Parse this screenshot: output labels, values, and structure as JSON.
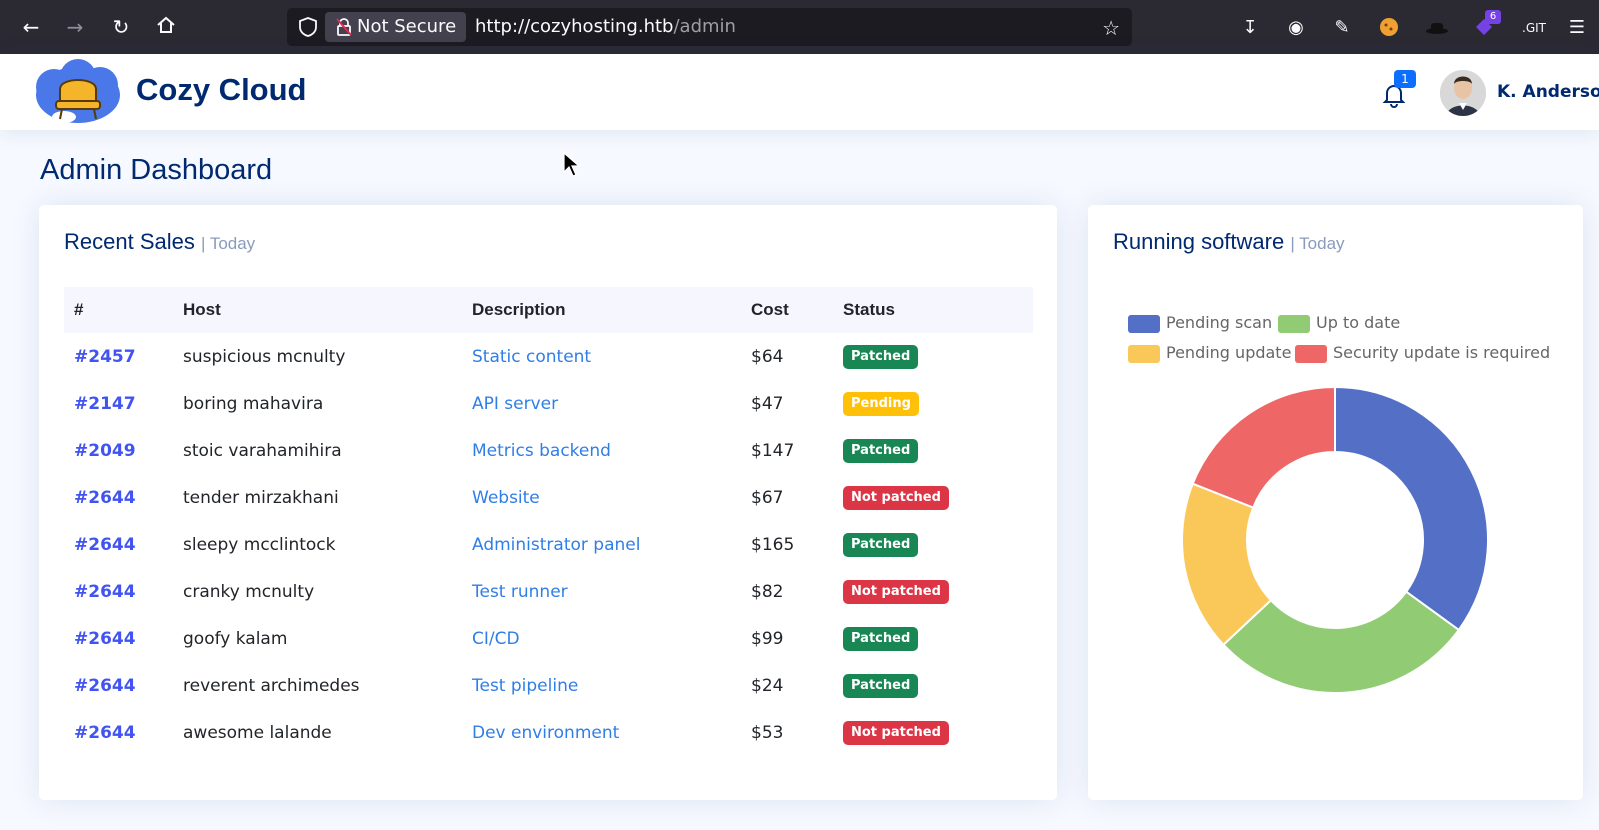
{
  "browser": {
    "security_label": "Not Secure",
    "url_host": "http://cozyhosting.htb",
    "url_path": "/admin",
    "extension_badge": "6"
  },
  "header": {
    "brand": "Cozy Cloud",
    "notification_count": "1",
    "user_name": "K. Anderson"
  },
  "page": {
    "title": "Admin Dashboard"
  },
  "sales": {
    "title": "Recent Sales",
    "subtitle": "| Today",
    "columns": [
      "#",
      "Host",
      "Description",
      "Cost",
      "Status"
    ],
    "rows": [
      {
        "id": "#2457",
        "host": "suspicious mcnulty",
        "description": "Static content",
        "cost": "$64",
        "status": "Patched",
        "status_color": "#198754"
      },
      {
        "id": "#2147",
        "host": "boring mahavira",
        "description": "API server",
        "cost": "$47",
        "status": "Pending",
        "status_color": "#ffc107"
      },
      {
        "id": "#2049",
        "host": "stoic varahamihira",
        "description": "Metrics backend",
        "cost": "$147",
        "status": "Patched",
        "status_color": "#198754"
      },
      {
        "id": "#2644",
        "host": "tender mirzakhani",
        "description": "Website",
        "cost": "$67",
        "status": "Not patched",
        "status_color": "#dc3545"
      },
      {
        "id": "#2644",
        "host": "sleepy mcclintock",
        "description": "Administrator panel",
        "cost": "$165",
        "status": "Patched",
        "status_color": "#198754"
      },
      {
        "id": "#2644",
        "host": "cranky mcnulty",
        "description": "Test runner",
        "cost": "$82",
        "status": "Not patched",
        "status_color": "#dc3545"
      },
      {
        "id": "#2644",
        "host": "goofy kalam",
        "description": "CI/CD",
        "cost": "$99",
        "status": "Patched",
        "status_color": "#198754"
      },
      {
        "id": "#2644",
        "host": "reverent archimedes",
        "description": "Test pipeline",
        "cost": "$24",
        "status": "Patched",
        "status_color": "#198754"
      },
      {
        "id": "#2644",
        "host": "awesome lalande",
        "description": "Dev environment",
        "cost": "$53",
        "status": "Not patched",
        "status_color": "#dc3545"
      }
    ]
  },
  "software": {
    "title": "Running software",
    "subtitle": "| Today"
  },
  "chart_data": {
    "type": "pie",
    "variant": "doughnut",
    "legend_position": "top",
    "series": [
      {
        "name": "Pending scan",
        "value": 35,
        "color": "#5470c6"
      },
      {
        "name": "Up to date",
        "value": 28,
        "color": "#91cc75"
      },
      {
        "name": "Pending update",
        "value": 18,
        "color": "#fac858"
      },
      {
        "name": "Security update is required",
        "value": 19,
        "color": "#ee6666"
      }
    ]
  },
  "colors": {
    "brand": "#012970",
    "link": "#2f7ee7",
    "id_link": "#4154f1"
  }
}
